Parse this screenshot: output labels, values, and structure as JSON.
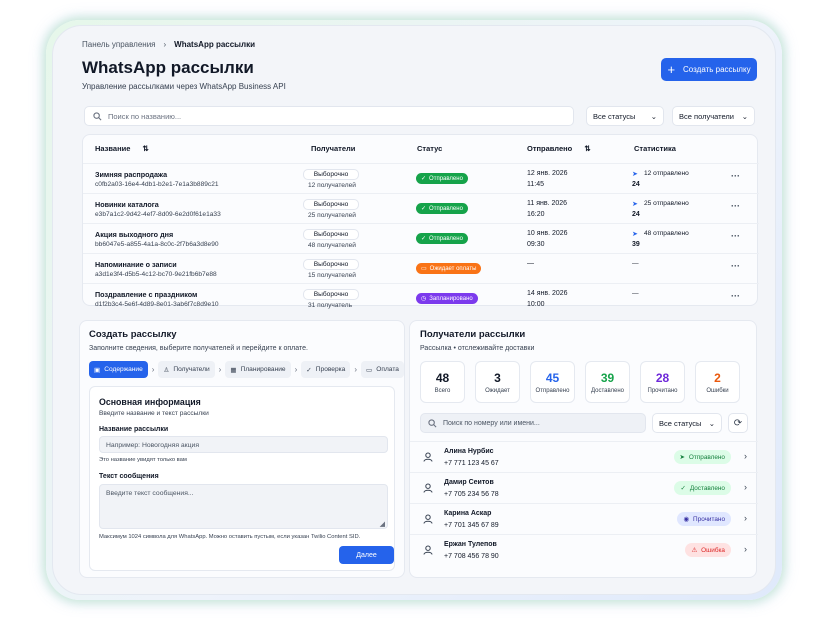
{
  "breadcrumb": {
    "root": "Панель управления",
    "current": "WhatsApp рассылки"
  },
  "page": {
    "title": "WhatsApp рассылки",
    "subtitle": "Управление рассылками через WhatsApp Business API"
  },
  "toolbar": {
    "create_label": "Создать рассылку"
  },
  "filters": {
    "search_placeholder": "Поиск по названию...",
    "status": "Все статусы",
    "recipients": "Все получатели"
  },
  "table": {
    "headers": {
      "name": "Название",
      "recipients": "Получатели",
      "status": "Статус",
      "sent": "Отправлено",
      "stats": "Статистика"
    },
    "rows": [
      {
        "name": "Зимняя распродажа",
        "id": "c0fb2a03-16e4-4db1-b2e1-7e1a3b889c21",
        "badge": "Выборочно",
        "count": "12 получателей",
        "status": "Отправлено",
        "date": "12 янв. 2026",
        "time": "11:45",
        "sent": "12 отправлено",
        "delivered": "24"
      },
      {
        "name": "Новинки каталога",
        "id": "e3b7a1c2-9d42-4ef7-8d09-6e2d0f61e1a33",
        "badge": "Выборочно",
        "count": "25 получателей",
        "status": "Отправлено",
        "date": "11 янв. 2026",
        "time": "16:20",
        "sent": "25 отправлено",
        "delivered": "24"
      },
      {
        "name": "Акция выходного дня",
        "id": "bb6047e5-a855-4a1a-8c0c-2f7b6a3d8e90",
        "badge": "Выборочно",
        "count": "48 получателей",
        "status": "Отправлено",
        "date": "10 янв. 2026",
        "time": "09:30",
        "sent": "48 отправлено",
        "delivered": "39"
      },
      {
        "name": "Напоминание о записи",
        "id": "a3d1e3f4-d5b5-4c12-bc70-9e21fb6b7e88",
        "badge": "Выборочно",
        "count": "15 получателей",
        "status": "Ожидает оплаты",
        "date": "—",
        "time": "",
        "sent": "—",
        "delivered": ""
      },
      {
        "name": "Поздравление с праздником",
        "id": "d1f2b3c4-5e6f-4d89-8e01-3ab6f7c8d9e10",
        "badge": "Выборочно",
        "count": "31 получатель",
        "status": "Запланировано",
        "date": "14 янв. 2026",
        "time": "10:00",
        "sent": "—",
        "delivered": ""
      }
    ]
  },
  "create_form": {
    "title": "Создать рассылку",
    "subtitle": "Заполните сведения, выберите получателей и перейдите к оплате.",
    "steps": [
      "Содержание",
      "Получатели",
      "Планирование",
      "Проверка",
      "Оплата"
    ],
    "section_title": "Основная информация",
    "section_subtitle": "Введите название и текст рассылки",
    "name_label": "Название рассылки",
    "name_placeholder": "Например: Новогодняя акция",
    "name_hint": "Это название увидят только вам",
    "message_label": "Текст сообщения",
    "message_placeholder": "Введите текст сообщения...",
    "message_hint": "Максимум 1024 символа для WhatsApp. Можно оставить пустым, если указан Twilio Content SID.",
    "next_label": "Далее"
  },
  "recipients_panel": {
    "title": "Получатели рассылки",
    "subtitle": "Рассылка • отслеживайте доставки",
    "stats": [
      {
        "value": "48",
        "label": "Всего",
        "color": "#111827"
      },
      {
        "value": "3",
        "label": "Ожидает",
        "color": "#111827"
      },
      {
        "value": "45",
        "label": "Отправлено",
        "color": "#2563eb"
      },
      {
        "value": "39",
        "label": "Доставлено",
        "color": "#16a34a"
      },
      {
        "value": "28",
        "label": "Прочитано",
        "color": "#6d28d9"
      },
      {
        "value": "2",
        "label": "Ошибки",
        "color": "#ea580c"
      }
    ],
    "search_placeholder": "Поиск по номеру или имени...",
    "status_filter": "Все статусы",
    "contacts": [
      {
        "name": "Алина Нурбис",
        "phone": "+7 771 123 45 67",
        "status": "Отправлено"
      },
      {
        "name": "Дамир Сеитов",
        "phone": "+7 705 234 56 78",
        "status": "Доставлено"
      },
      {
        "name": "Карина Аскар",
        "phone": "+7 701 345 67 89",
        "status": "Прочитано"
      },
      {
        "name": "Ержан Тулепов",
        "phone": "+7 708 456 78 90",
        "status": "Ошибка"
      }
    ]
  },
  "colors": {
    "accent": "#2563eb",
    "sent": "#16a34a",
    "pending": "#f97316",
    "scheduled": "#7c3aed"
  }
}
